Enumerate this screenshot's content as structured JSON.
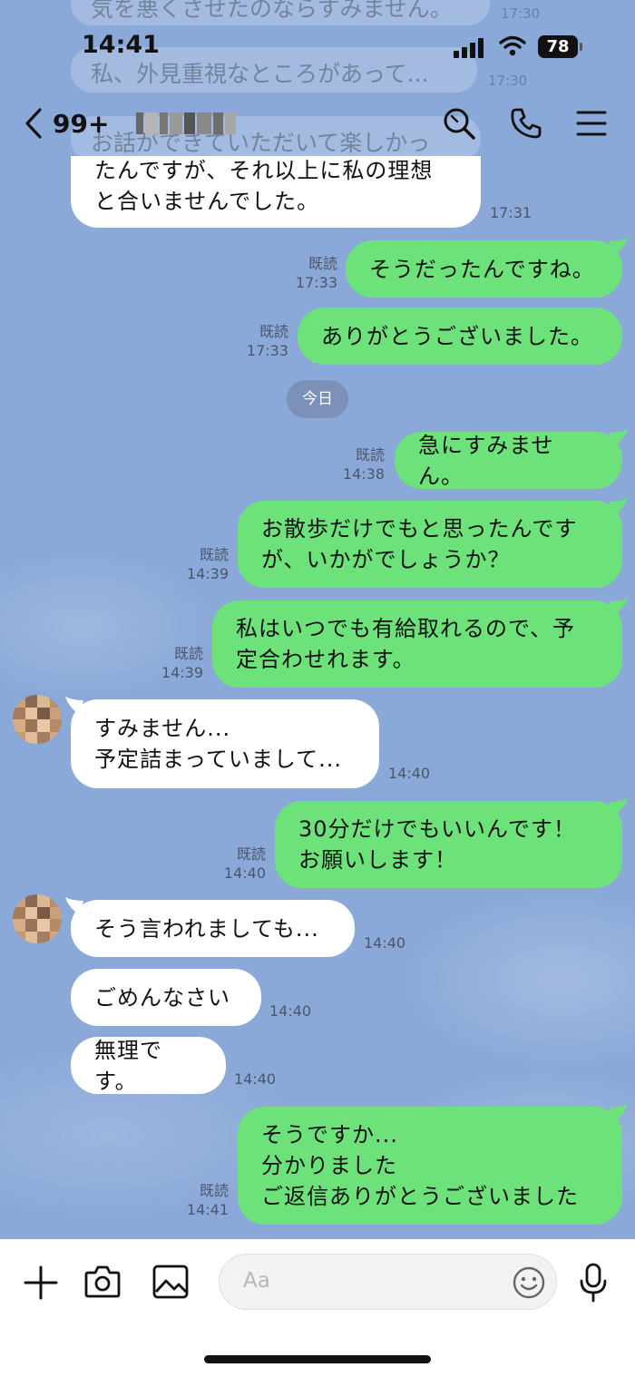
{
  "status_bar": {
    "time": "14:41",
    "battery": "78"
  },
  "header": {
    "unread_count": "99+",
    "contact_name": ""
  },
  "ghost_messages": [
    {
      "text": "気を悪くさせたのならすみません。",
      "time": "17:30"
    },
    {
      "text": "私、外見重視なところがあって...",
      "time": "17:30"
    },
    {
      "text": "お話ができていただいて楽しかっ",
      "time": ""
    }
  ],
  "day_separator": "今日",
  "messages": [
    {
      "side": "them",
      "text": "たんですが、それ以上に私の理想\nと合いませんでした。",
      "time": "17:31",
      "avatar": false
    },
    {
      "side": "me",
      "text": "そうだったんですね。",
      "read": "既読",
      "time": "17:33"
    },
    {
      "side": "me",
      "text": "ありがとうございました。",
      "read": "既読",
      "time": "17:33"
    },
    {
      "side": "me",
      "text": "急にすみません。",
      "read": "既読",
      "time": "14:38"
    },
    {
      "side": "me",
      "text": "お散歩だけでもと思ったんです\nが、いかがでしょうか？",
      "read": "既読",
      "time": "14:39"
    },
    {
      "side": "me",
      "text": "私はいつでも有給取れるので、予\n定合わせれます。",
      "read": "既読",
      "time": "14:39"
    },
    {
      "side": "them",
      "text": "すみません...\n予定詰まっていまして...",
      "time": "14:40",
      "avatar": true
    },
    {
      "side": "me",
      "text": "30分だけでもいいんです！\nお願いします！",
      "read": "既読",
      "time": "14:40"
    },
    {
      "side": "them",
      "text": "そう言われましても...",
      "time": "14:40",
      "avatar": true
    },
    {
      "side": "them",
      "text": "ごめんなさい",
      "time": "14:40",
      "avatar": false
    },
    {
      "side": "them",
      "text": "無理です。",
      "time": "14:40",
      "avatar": false
    },
    {
      "side": "me",
      "text": "そうですか...\n分かりました\nご返信ありがとうございました",
      "read": "既読",
      "time": "14:41"
    }
  ],
  "input": {
    "placeholder": "Aa"
  },
  "icons": {
    "back": "chevron-left-icon",
    "search": "search-icon",
    "call": "phone-icon",
    "menu": "menu-icon",
    "add": "plus-icon",
    "camera": "camera-icon",
    "image": "image-icon",
    "emoji": "emoji-icon",
    "mic": "mic-icon"
  },
  "colors": {
    "background": "#8aa8d8",
    "my_bubble": "#6de27a",
    "their_bubble": "#ffffff",
    "meta_text": "#4c5668"
  }
}
